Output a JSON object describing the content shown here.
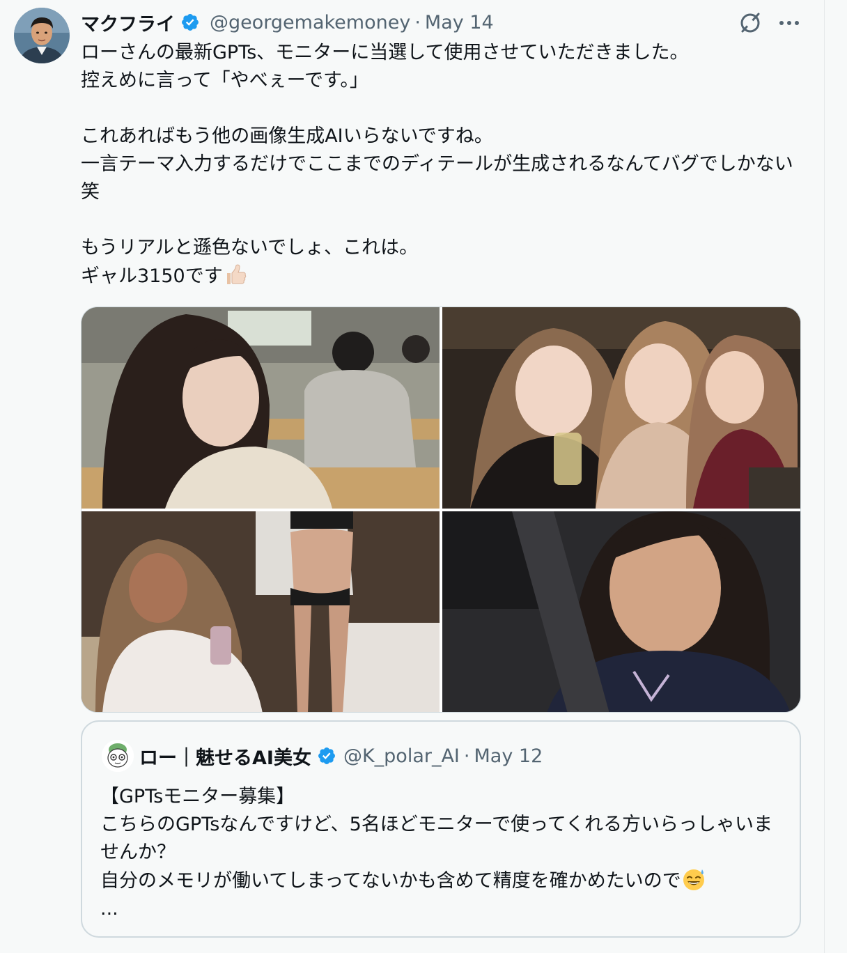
{
  "tweet": {
    "display_name": "マクフライ",
    "handle": "@georgemakemoney",
    "separator": "·",
    "date": "May 14",
    "text": "ローさんの最新GPTs、モニターに当選して使用させていただきました。\n控えめに言って「やべぇーです。」\n\nこれあればもう他の画像生成AIいらないですね。\n一言テーマ入力するだけでここまでのディテールが生成されるなんてバグでしかない笑\n\nもうリアルと遜色ないでしょ、これは。\nギャル3150です",
    "emoji": "thumbs-up-icon"
  },
  "media": [
    {
      "name": "photo-lecture-hall-selfie"
    },
    {
      "name": "photo-three-women-bar"
    },
    {
      "name": "photo-two-women-room"
    },
    {
      "name": "photo-car-selfie"
    }
  ],
  "quote": {
    "display_name": "ロー｜魅せるAI美女",
    "handle": "@K_polar_AI",
    "separator": "·",
    "date": "May 12",
    "text": "【GPTsモニター募集】\nこちらのGPTsなんですけど、5名ほどモニターで使ってくれる方いらっしゃいませんか？\n自分のメモリが働いてしまってないかも含めて精度を確かめたいので",
    "emoji": "sweat-smile-icon",
    "ellipsis": "..."
  },
  "colors": {
    "background": "#f7f9f9",
    "text_primary": "#0f1419",
    "text_secondary": "#536471",
    "verified_blue": "#1d9bf0",
    "border": "#cfd9de"
  }
}
